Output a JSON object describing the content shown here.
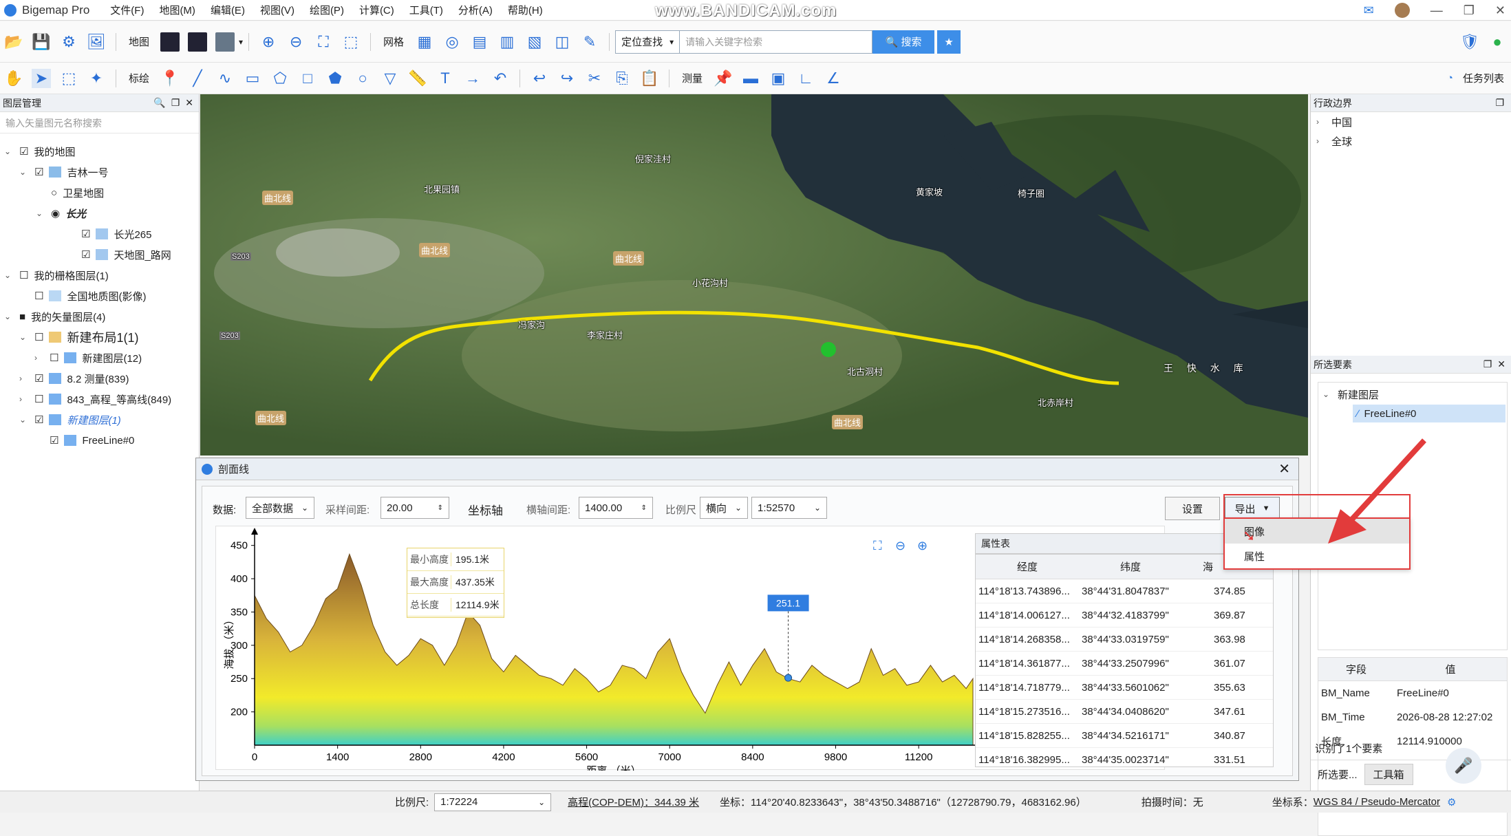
{
  "app": {
    "title": "Bigemap Pro",
    "watermark": "www.BANDICAM.com"
  },
  "menu": [
    "文件(F)",
    "地图(M)",
    "编辑(E)",
    "视图(V)",
    "绘图(P)",
    "计算(C)",
    "工具(T)",
    "分析(A)",
    "帮助(H)"
  ],
  "toolbar1": {
    "map_label": "地图",
    "grid_label": "网格",
    "search_mode": "定位查找",
    "search_placeholder": "请输入关键字检索",
    "search_btn": "搜索"
  },
  "toolbar2": {
    "annotate_label": "标绘",
    "measure_label": "测量",
    "tasks_label": "任务列表"
  },
  "layer_panel": {
    "title": "图层管理",
    "search_placeholder": "输入矢量图元名称搜索",
    "items": [
      {
        "label": "我的地图",
        "checked": "☑"
      },
      {
        "label": "吉林一号",
        "checked": "☑"
      },
      {
        "label": "卫星地图",
        "checked": "○"
      },
      {
        "label": "长光",
        "checked": "◉"
      },
      {
        "label": "长光265",
        "checked": "☑"
      },
      {
        "label": "天地图_路网",
        "checked": "☑"
      },
      {
        "label": "我的栅格图层(1)",
        "checked": "☐"
      },
      {
        "label": "全国地质图(影像)",
        "checked": "☐"
      },
      {
        "label": "我的矢量图层(4)",
        "checked": "■"
      },
      {
        "label": "新建布局1(1)",
        "checked": "☐"
      },
      {
        "label": "新建图层(12)",
        "checked": "☐"
      },
      {
        "label": "8.2 测量(839)",
        "checked": "☑"
      },
      {
        "label": "843_高程_等高线(849)",
        "checked": "☐"
      },
      {
        "label": "新建图层(1)",
        "checked": "☑"
      },
      {
        "label": "FreeLine#0",
        "checked": "☑"
      }
    ]
  },
  "map_labels": [
    "倪家洼村",
    "北果园镇",
    "黄家坡",
    "椅子圈",
    "曲北线",
    "小花沟村",
    "李家庄村",
    "冯家沟",
    "北古洞村",
    "北赤岸村",
    "S203",
    "S203",
    "曲北线",
    "曲北线",
    "曲北线",
    "曲北线",
    "王 快 水 库"
  ],
  "right_panel": {
    "admin_title": "行政边界",
    "admin_items": [
      "中国",
      "全球"
    ],
    "selected_title": "所选要素",
    "selected_layer": "新建图层",
    "selected_item": "FreeLine#0",
    "prop_headers": [
      "字段",
      "值"
    ],
    "props": [
      {
        "k": "BM_Name",
        "v": "FreeLine#0"
      },
      {
        "k": "BM_Time",
        "v": "2026-08-28 12:27:02"
      },
      {
        "k": "长度",
        "v": "12114.910000"
      }
    ],
    "recognized": "识别了1个要素",
    "tab1": "所选要...",
    "tab2": "工具箱"
  },
  "profile": {
    "title": "剖面线",
    "data_label": "数据:",
    "data_value": "全部数据",
    "sample_label": "采样间距:",
    "sample_value": "20.00",
    "axis_label": "坐标轴",
    "xinterval_label": "横轴间距:",
    "xinterval_value": "1400.00",
    "scale_label": "比例尺",
    "orient_value": "横向",
    "scale_value": "1:52570",
    "settings_btn": "设置",
    "export_btn": "导出",
    "export_menu": [
      "图像",
      "属性"
    ],
    "stats": [
      {
        "k": "最小高度",
        "v": "195.1米"
      },
      {
        "k": "最大高度",
        "v": "437.35米"
      },
      {
        "k": "总长度",
        "v": "12114.9米"
      }
    ],
    "marker_value": "251.1",
    "table_title": "属性表",
    "table_headers": [
      "经度",
      "纬度",
      "海"
    ],
    "table_rows": [
      [
        "114°18'13.743896...",
        "38°44'31.8047837\"",
        "374.85"
      ],
      [
        "114°18'14.006127...",
        "38°44'32.4183799\"",
        "369.87"
      ],
      [
        "114°18'14.268358...",
        "38°44'33.0319759\"",
        "363.98"
      ],
      [
        "114°18'14.361877...",
        "38°44'33.2507996\"",
        "361.07"
      ],
      [
        "114°18'14.718779...",
        "38°44'33.5601062\"",
        "355.63"
      ],
      [
        "114°18'15.273516...",
        "38°44'34.0408620\"",
        "347.61"
      ],
      [
        "114°18'15.828255...",
        "38°44'34.5216171\"",
        "340.87"
      ],
      [
        "114°18'16.382995...",
        "38°44'35.0023714\"",
        "331.51"
      ]
    ]
  },
  "chart_data": {
    "type": "area",
    "xlabel": "距离 （米）",
    "ylabel": "海拔 （米）",
    "xlim": [
      0,
      12114.9
    ],
    "ylim": [
      150,
      460
    ],
    "xticks": [
      0,
      1400,
      2800,
      4200,
      5600,
      7000,
      8400,
      9800,
      11200
    ],
    "yticks": [
      200,
      250,
      300,
      350,
      400,
      450
    ],
    "x": [
      0,
      200,
      400,
      600,
      800,
      1000,
      1200,
      1400,
      1600,
      1800,
      2000,
      2200,
      2400,
      2600,
      2800,
      3000,
      3200,
      3400,
      3600,
      3800,
      4000,
      4200,
      4400,
      4600,
      4800,
      5000,
      5200,
      5400,
      5600,
      5800,
      6000,
      6200,
      6400,
      6600,
      6800,
      7000,
      7200,
      7400,
      7600,
      7800,
      8000,
      8200,
      8400,
      8600,
      8800,
      9000,
      9200,
      9400,
      9600,
      9800,
      10000,
      10200,
      10400,
      10600,
      10800,
      11000,
      11200,
      11400,
      11600,
      11800,
      12000,
      12114.9
    ],
    "y": [
      375,
      340,
      320,
      290,
      300,
      330,
      370,
      385,
      437,
      390,
      330,
      290,
      270,
      285,
      310,
      300,
      270,
      300,
      350,
      330,
      280,
      260,
      285,
      270,
      255,
      250,
      240,
      265,
      250,
      230,
      240,
      270,
      265,
      250,
      290,
      310,
      260,
      225,
      198,
      240,
      275,
      240,
      270,
      295,
      260,
      250,
      245,
      270,
      255,
      245,
      235,
      245,
      295,
      255,
      265,
      240,
      245,
      270,
      245,
      255,
      235,
      250
    ],
    "marker": {
      "x": 9000,
      "y": 251.1
    }
  },
  "statusbar": {
    "scale_label": "比例尺:",
    "scale_value": "1:72224",
    "elev": "高程(COP-DEM)：344.39 米",
    "coord": "坐标：114°20'40.8233643\"，38°43'50.3488716\"（12728790.79，4683162.96）",
    "capture": "拍摄时间：无",
    "crs_label": "坐标系：",
    "crs_value": "WGS 84 / Pseudo-Mercator"
  }
}
